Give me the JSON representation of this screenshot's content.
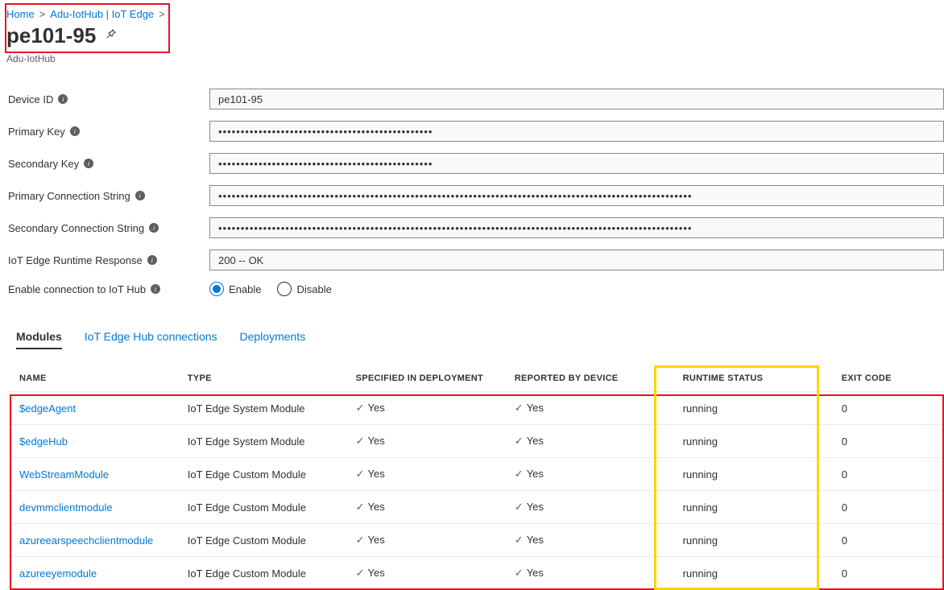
{
  "breadcrumb": {
    "home": "Home",
    "hub": "Adu-IotHub | IoT Edge"
  },
  "page_title": "pe101-95",
  "subtitle": "Adu-IotHub",
  "fields": {
    "device_id": {
      "label": "Device ID",
      "value": "pe101-95"
    },
    "primary_key": {
      "label": "Primary Key",
      "value": "••••••••••••••••••••••••••••••••••••••••••••••••"
    },
    "secondary_key": {
      "label": "Secondary Key",
      "value": "••••••••••••••••••••••••••••••••••••••••••••••••"
    },
    "primary_conn": {
      "label": "Primary Connection String",
      "value": "••••••••••••••••••••••••••••••••••••••••••••••••••••••••••••••••••••••••••••••••••••••••••••••••••••••••••"
    },
    "secondary_conn": {
      "label": "Secondary Connection String",
      "value": "••••••••••••••••••••••••••••••••••••••••••••••••••••••••••••••••••••••••••••••••••••••••••••••••••••••••••"
    },
    "runtime_response": {
      "label": "IoT Edge Runtime Response",
      "value": "200 -- OK"
    },
    "enable_conn": {
      "label": "Enable connection to IoT Hub",
      "enable": "Enable",
      "disable": "Disable"
    }
  },
  "tabs": {
    "modules": "Modules",
    "hub_conn": "IoT Edge Hub connections",
    "deployments": "Deployments"
  },
  "table": {
    "headers": {
      "name": "Name",
      "type": "Type",
      "spec": "Specified in Deployment",
      "report": "Reported by Device",
      "runtime": "Runtime Status",
      "exit": "Exit Code"
    },
    "yes": "Yes",
    "rows": [
      {
        "name": "$edgeAgent",
        "type": "IoT Edge System Module",
        "spec": true,
        "report": true,
        "runtime": "running",
        "exit": "0"
      },
      {
        "name": "$edgeHub",
        "type": "IoT Edge System Module",
        "spec": true,
        "report": true,
        "runtime": "running",
        "exit": "0"
      },
      {
        "name": "WebStreamModule",
        "type": "IoT Edge Custom Module",
        "spec": true,
        "report": true,
        "runtime": "running",
        "exit": "0"
      },
      {
        "name": "devmmclientmodule",
        "type": "IoT Edge Custom Module",
        "spec": true,
        "report": true,
        "runtime": "running",
        "exit": "0"
      },
      {
        "name": "azureearspeechclientmodule",
        "type": "IoT Edge Custom Module",
        "spec": true,
        "report": true,
        "runtime": "running",
        "exit": "0"
      },
      {
        "name": "azureeyemodule",
        "type": "IoT Edge Custom Module",
        "spec": true,
        "report": true,
        "runtime": "running",
        "exit": "0"
      }
    ]
  }
}
